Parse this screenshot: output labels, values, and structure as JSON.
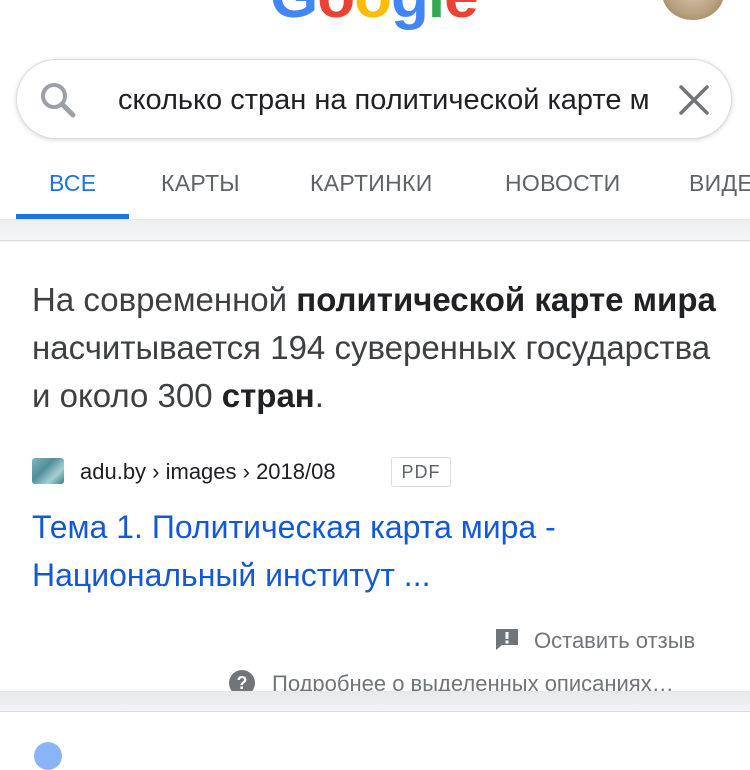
{
  "header": {
    "logo_letters": [
      {
        "ch": "G",
        "color": "#4285F4"
      },
      {
        "ch": "o",
        "color": "#EA4335"
      },
      {
        "ch": "o",
        "color": "#FBBC05"
      },
      {
        "ch": "g",
        "color": "#4285F4"
      },
      {
        "ch": "l",
        "color": "#34A853"
      },
      {
        "ch": "e",
        "color": "#EA4335"
      }
    ]
  },
  "search": {
    "query": "сколько стран на политической карте мира"
  },
  "tabs": [
    {
      "label": "ВСЕ",
      "active": true
    },
    {
      "label": "КАРТЫ",
      "active": false
    },
    {
      "label": "КАРТИНКИ",
      "active": false
    },
    {
      "label": "НОВОСТИ",
      "active": false
    },
    {
      "label": "ВИДЕО",
      "active": false
    }
  ],
  "snippet": {
    "part1": "На современной ",
    "bold1": "политической карте мира",
    "part2": " насчитывается 194 суверенных государства и около 300 ",
    "bold2": "стран",
    "part3": "."
  },
  "result": {
    "source": "adu.by › images › 2018/08",
    "badge": "PDF",
    "title_line1": "Тема 1. Политическая карта мира -",
    "title_line2": "Национальный институт ..."
  },
  "feedback": {
    "feedback_label": "Оставить отзыв",
    "about_label": "Подробнее о выделенных описаниях…"
  },
  "colors": {
    "accent": "#1a73e8",
    "link": "#1558d6",
    "muted": "#70757a"
  }
}
